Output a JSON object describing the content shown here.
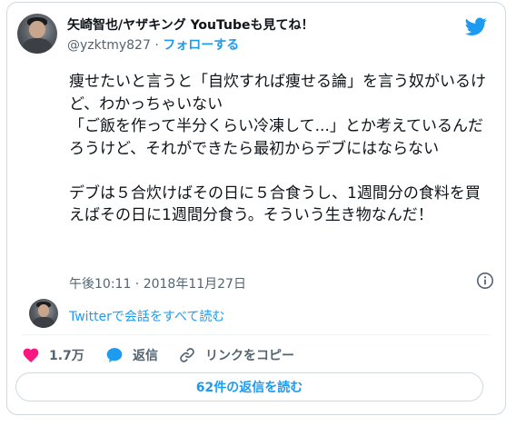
{
  "author": {
    "display_name": "矢崎智也/ヤザキング YouTubeも見てね！",
    "handle": "@yzktmy827",
    "separator": "·",
    "follow_label": "フォローする"
  },
  "tweet": {
    "text": "痩せたいと言うと「自炊すれば痩せる論」を言う奴がいるけど、わかっちゃいない\n「ご飯を作って半分くらい冷凍して...」とか考えているんだろうけど、それができたら最初からデブにはならない\n\nデブは５合炊けばその日に５合食うし、1週間分の食料を買えばその日に1週間分食う。そういう生き物なんだ！",
    "timestamp": "午後10:11 · 2018年11月27日"
  },
  "conversation": {
    "link_label": "Twitterで会話をすべて読む"
  },
  "actions": {
    "like_count": "1.7万",
    "reply_label": "返信",
    "copy_link_label": "リンクをコピー"
  },
  "replies_button_label": "62件の返信を読む",
  "icons": {
    "logo": "twitter-bird-icon",
    "info": "info-icon",
    "like": "heart-icon",
    "reply": "speech-bubble-icon",
    "link": "link-icon"
  },
  "colors": {
    "accent": "#1d9bf0",
    "like": "#f91880",
    "text": "#0f1419",
    "muted": "#536471",
    "border": "#cfd9de"
  }
}
